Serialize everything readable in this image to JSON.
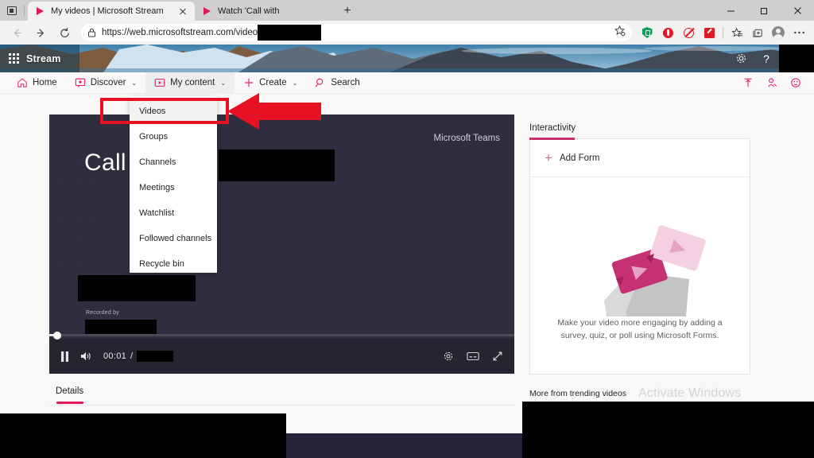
{
  "browser": {
    "tabs": [
      {
        "title": "My videos | Microsoft Stream",
        "favicon": "stream-icon",
        "active": true,
        "close_label": "×"
      },
      {
        "title": "Watch 'Call with",
        "favicon": "stream-icon",
        "active": false,
        "close_label": ""
      }
    ],
    "new_tab_label": "+",
    "url": "https://web.microsoftstream.com/video,",
    "url_lock_icon": "lock-icon",
    "back_icon": "back-arrow-icon",
    "forward_icon": "forward-arrow-icon",
    "reload_icon": "reload-icon",
    "favorite_icon": "add-favorite-icon",
    "extensions": [
      {
        "name": "shield-extension-icon",
        "color": "#11a05a"
      },
      {
        "name": "opera-extension-icon",
        "color": "#e01b24"
      },
      {
        "name": "adblock-extension-icon",
        "color": "#e01b24"
      },
      {
        "name": "pen-extension-icon",
        "color": "#e01b24"
      }
    ],
    "collections_icon": "collections-icon",
    "favorites_icon": "favorites-icon",
    "profile_icon": "profile-avatar-icon",
    "settings_icon": "more-options-icon",
    "window_controls": {
      "minimize": "minimize-icon",
      "maximize": "maximize-icon",
      "close": "close-icon"
    }
  },
  "stream_header": {
    "app_launcher_icon": "waffle-icon",
    "brand": "Stream",
    "settings_icon": "gear-icon",
    "help_label": "?"
  },
  "stream_nav": {
    "items": [
      {
        "label": "Home",
        "icon": "home-icon",
        "has_chevron": false,
        "active": false
      },
      {
        "label": "Discover",
        "icon": "discover-icon",
        "has_chevron": true,
        "active": false
      },
      {
        "label": "My content",
        "icon": "my-content-icon",
        "has_chevron": true,
        "active": true
      },
      {
        "label": "Create",
        "icon": "plus-icon",
        "has_chevron": true,
        "active": false
      },
      {
        "label": "Search",
        "icon": "search-icon",
        "has_chevron": false,
        "active": false
      }
    ],
    "right_icons": [
      {
        "name": "upload-icon"
      },
      {
        "name": "add-person-icon"
      },
      {
        "name": "feedback-smiley-icon"
      }
    ],
    "chevron_glyph": "⌄"
  },
  "dropdown": {
    "items": [
      {
        "label": "Videos",
        "highlighted": true
      },
      {
        "label": "Groups",
        "highlighted": false
      },
      {
        "label": "Channels",
        "highlighted": false
      },
      {
        "label": "Meetings",
        "highlighted": false
      },
      {
        "label": "Watchlist",
        "highlighted": false
      },
      {
        "label": "Followed channels",
        "highlighted": false
      },
      {
        "label": "Recycle bin",
        "highlighted": false
      }
    ]
  },
  "annotations": {
    "highlight_box_color": "#e81123",
    "arrow_color": "#e81123",
    "arrow_direction": "left"
  },
  "player": {
    "title": "Call",
    "watermark": "Microsoft Teams",
    "recorded_by_label": "Recorded by",
    "pause_icon": "pause-icon",
    "volume_icon": "volume-icon",
    "current_time": "00:01",
    "time_separator": "/",
    "duration": "",
    "settings_icon": "gear-icon",
    "captions_icon": "captions-icon",
    "fullscreen_icon": "fullscreen-icon",
    "progress_percent": 1
  },
  "details": {
    "tabs": [
      {
        "label": "Details",
        "active": true
      }
    ]
  },
  "side_panel": {
    "title": "Interactivity",
    "add_form_label": "Add Form",
    "add_form_icon": "plus-icon",
    "empty_text_line1": "Make your video more engaging by adding a",
    "empty_text_line2": "survey, quiz, or poll using Microsoft Forms.",
    "more_trending_label": "More from trending videos",
    "accent_color": "#c9306e"
  },
  "watermark": {
    "activate_windows": "Activate Windows"
  }
}
